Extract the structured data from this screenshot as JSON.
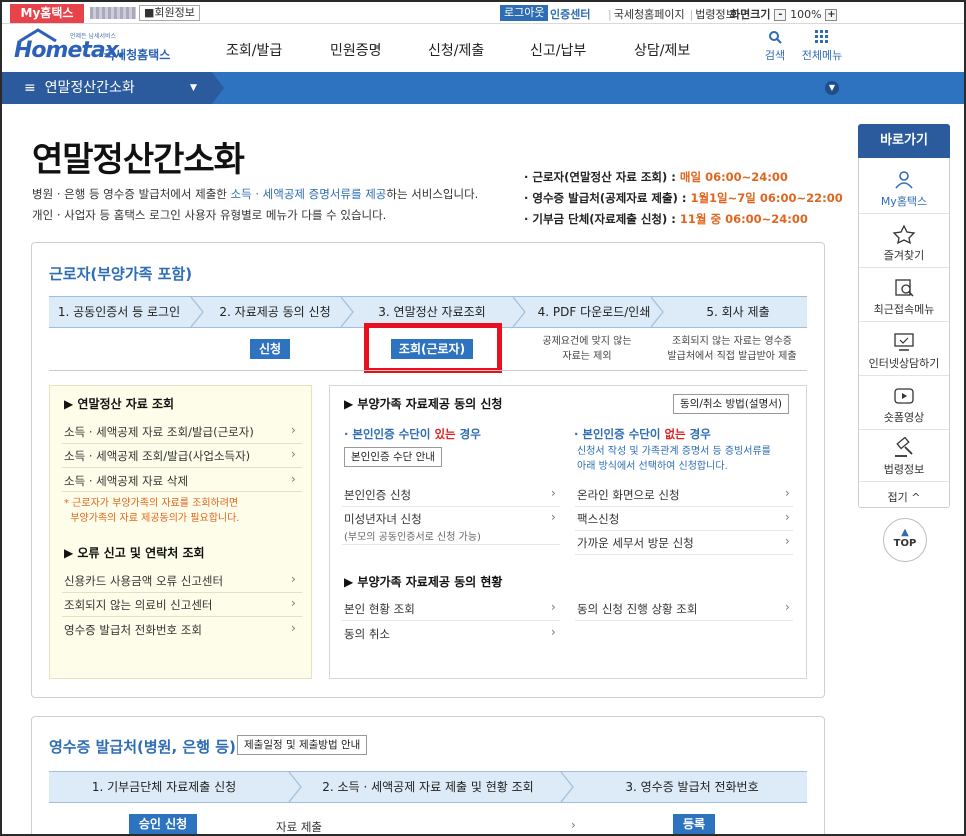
{
  "util": {
    "my_tab": "My홈택스",
    "member_info": "회원정보",
    "logout": "로그아웃",
    "cert_center": "인증센터",
    "nts_page": "국세청홈페이지",
    "law_info": "법령정보",
    "screen_size": "화면크기",
    "zoom_minus": "-",
    "zoom_value": "100%",
    "zoom_plus": "+"
  },
  "logo": {
    "small": "언제든 납세서비스",
    "brand": "Hometax.",
    "korean": "국세청홈택스"
  },
  "gnb": [
    "조회/발급",
    "민원증명",
    "신청/제출",
    "신고/납부",
    "상담/제보"
  ],
  "header_tools": {
    "search": "검색",
    "all_menu": "전체메뉴"
  },
  "breadcrumb": {
    "title": "연말정산간소화"
  },
  "page": {
    "title": "연말정산간소화",
    "desc1_a": "병원 · 은행 등 영수증 발급처에서 제출한 ",
    "desc1_hl": "소득 · 세액공제 증명서류를 제공",
    "desc1_b": "하는 서비스입니다.",
    "desc2": "개인 · 사업자 등 홈택스 로그인 사용자 유형별로 메뉴가 다를 수 있습니다.",
    "sched": [
      {
        "label": "· 근로자(연말정산 자료 조회) : ",
        "day": "매일 ",
        "time": "06:00~24:00"
      },
      {
        "label": "· 영수증 발급처(공제자료 제출) : ",
        "day": "1월1일~7일 ",
        "time": "06:00~22:00"
      },
      {
        "label": "· 기부금 단체(자료제출 신청) : ",
        "day": "11월 중 ",
        "time": "06:00~24:00"
      }
    ]
  },
  "worker": {
    "title": "근로자(부양가족 포함)",
    "steps": [
      "1. 공동인증서 등 로그인",
      "2. 자료제공 동의 신청",
      "3. 연말정산 자료조회",
      "4. PDF 다운로드/인쇄",
      "5. 회사 제출"
    ],
    "apply_btn": "신청",
    "inquiry_btn": "조회(근로자)",
    "note4": "공제요건에 맞지 않는\n자료는 제외",
    "note5": "조회되지 않는 자료는 영수증\n발급처에서 직접 발급받아 제출",
    "left": {
      "h1": "▶ 연말정산 자료 조회",
      "items1": [
        "소득 · 세액공제 자료 조회/발급(근로자)",
        "소득 · 세액공제 조회/발급(사업소득자)",
        "소득 · 세액공제 자료 삭제"
      ],
      "warn": "* 근로자가 부양가족의 자료를 조회하려면\n  부양가족의 자료 제공동의가 필요합니다.",
      "h2": "▶ 오류 신고 및 연락처 조회",
      "items2": [
        "신용카드 사용금액 오류 신고센터",
        "조회되지 않는 의료비 신고센터",
        "영수증 발급처 전화번호 조회"
      ]
    },
    "right": {
      "h1": "▶ 부양가족 자료제공 동의 신청",
      "guide_btn": "동의/취소 방법(설명서)",
      "has_auth_a": "· 본인인증 수단이 ",
      "has_auth_b": "있는",
      "has_auth_c": " 경우",
      "auth_guide_btn": "본인인증 수단 안내",
      "no_auth_a": "· 본인인증 수단이 ",
      "no_auth_b": "없는",
      "no_auth_c": " 경우",
      "no_auth_desc": "신청서 작성 및 가족관계 증명서 등 증빙서류를\n아래 방식에서 선택하여 신청합니다.",
      "left_items": [
        "본인인증 신청",
        "미성년자녀 신청"
      ],
      "minor_sub": "(부모의 공동인증서로 신청 가능)",
      "right_items": [
        "온라인 화면으로 신청",
        "팩스신청",
        "가까운 세무서 방문 신청"
      ],
      "h2": "▶ 부양가족 자료제공 동의 현황",
      "status_left": [
        "본인 현황 조회",
        "동의 취소"
      ],
      "status_right": [
        "동의 신청 진행 상황 조회"
      ]
    }
  },
  "receipt": {
    "title": "영수증 발급처(병원, 은행 등)",
    "schedule_btn": "제출일정 및 제출방법 안내",
    "steps": [
      "1. 기부금단체 자료제출 신청",
      "2. 소득 · 세액공제 자료 제출 및 현황 조회",
      "3. 영수증 발급처 전화번호"
    ],
    "approve_btn": "승인 신청",
    "submit_item": "자료 제출",
    "register_btn": "등록"
  },
  "quick": {
    "title": "바로가기",
    "items": [
      "My홈택스",
      "즐겨찾기",
      "최근접속메뉴",
      "인터넷상담하기",
      "숏폼영상",
      "법령정보"
    ],
    "collapse": "접기 ^",
    "top": "TOP"
  },
  "colors": {
    "accent": "#2e73c0",
    "highlight_red": "#e8101e",
    "time_orange": "#e0651f",
    "mytab_red": "#e8424a"
  }
}
